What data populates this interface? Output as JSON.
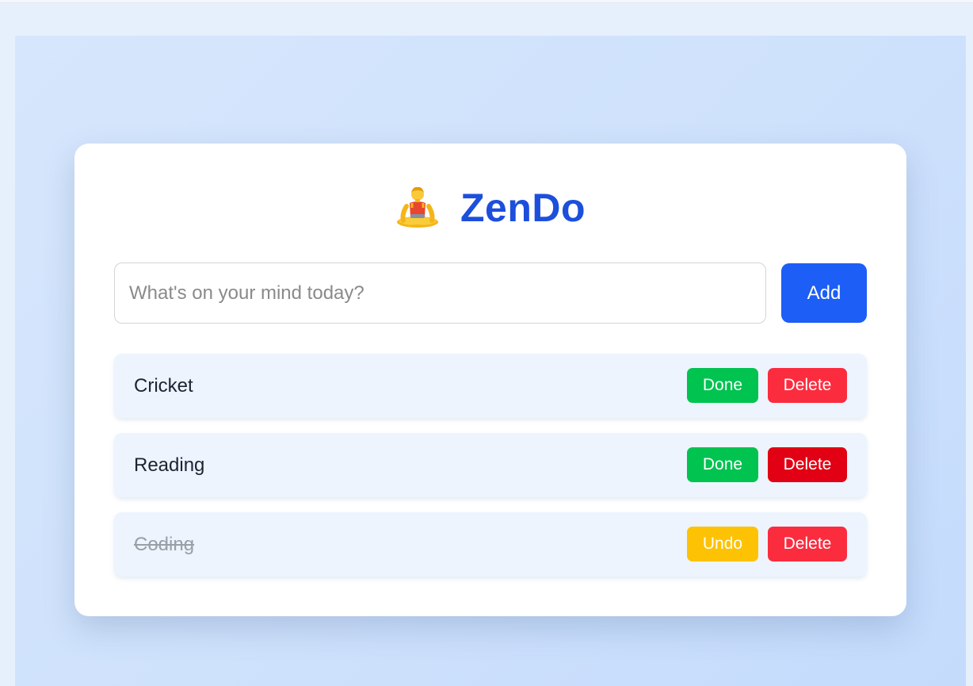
{
  "app": {
    "title": "ZenDo",
    "logo_icon": "meditating-person-icon"
  },
  "input": {
    "placeholder": "What's on your mind today?",
    "value": ""
  },
  "add_button": {
    "label": "Add"
  },
  "colors": {
    "accent": "#1c5ef6",
    "title": "#1c4fdc",
    "done": "#00c350",
    "undo": "#fdc203",
    "delete": "#fc2c3f",
    "delete_hover": "#e20014"
  },
  "tasks": [
    {
      "label": "Cricket",
      "completed": false,
      "primary_action": "Done",
      "delete_label": "Delete"
    },
    {
      "label": "Reading",
      "completed": false,
      "primary_action": "Done",
      "delete_label": "Delete"
    },
    {
      "label": "Coding",
      "completed": true,
      "primary_action": "Undo",
      "delete_label": "Delete"
    }
  ]
}
